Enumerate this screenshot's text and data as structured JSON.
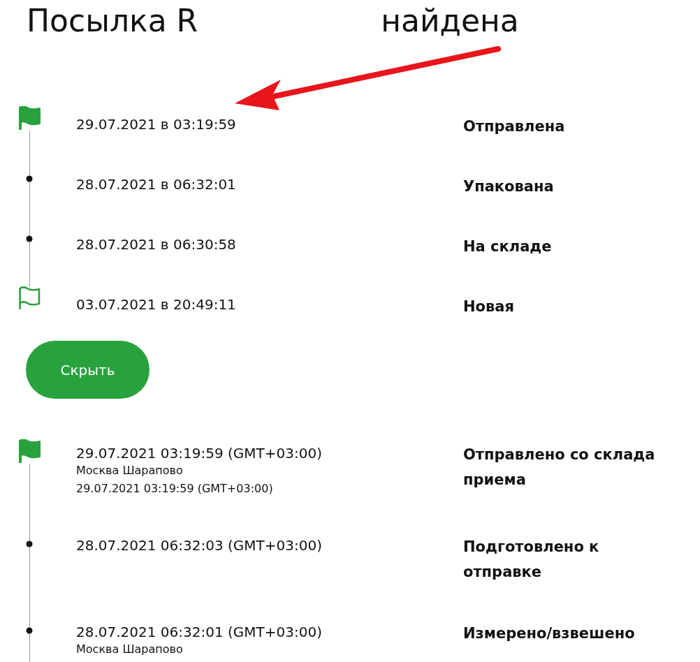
{
  "title": {
    "prefix": "Посылка R",
    "suffix": "найдена"
  },
  "events": [
    {
      "kind": "flag_filled",
      "date": "29.07.2021 в 03:19:59",
      "status": "Отправлена"
    },
    {
      "kind": "dot",
      "date": "28.07.2021 в 06:32:01",
      "status": "Упакована"
    },
    {
      "kind": "dot",
      "date": "28.07.2021 в 06:30:58",
      "status": "На складе"
    },
    {
      "kind": "flag_outline",
      "date": "03.07.2021 в 20:49:11",
      "status": "Новая"
    }
  ],
  "hide_button": "Скрыть",
  "details": [
    {
      "kind": "flag_filled",
      "date": "29.07.2021 03:19:59 (GMT+03:00)",
      "place": "Москва Шарапово",
      "place_date": "29.07.2021 03:19:59 (GMT+03:00)",
      "status": "Отправлено со склада приема"
    },
    {
      "kind": "dot",
      "date": "28.07.2021 06:32:03 (GMT+03:00)",
      "status": "Подготовлено к отправке"
    },
    {
      "kind": "dot",
      "date": "28.07.2021 06:32:01 (GMT+03:00)",
      "place": "Москва Шарапово",
      "status": "Измерено/взвешено"
    }
  ]
}
